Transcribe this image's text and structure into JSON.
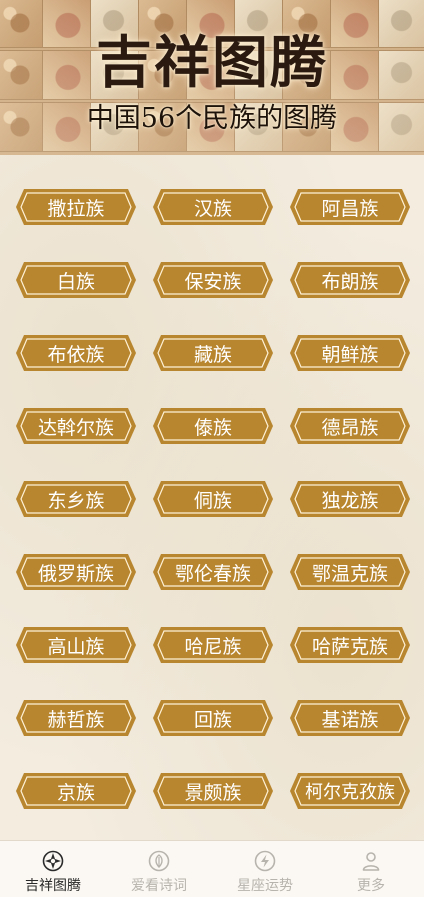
{
  "banner": {
    "title": "吉祥图腾",
    "subtitle": "中国56个民族的图腾"
  },
  "colors": {
    "pill_fill": "#b8862f",
    "pill_border": "#fff1d6",
    "background": "#f3ecdf",
    "tab_active": "#2a2a2a",
    "tab_inactive": "#b7b3ad"
  },
  "ethnic_groups": [
    "撒拉族",
    "汉族",
    "阿昌族",
    "白族",
    "保安族",
    "布朗族",
    "布依族",
    "藏族",
    "朝鲜族",
    "达斡尔族",
    "傣族",
    "德昂族",
    "东乡族",
    "侗族",
    "独龙族",
    "俄罗斯族",
    "鄂伦春族",
    "鄂温克族",
    "高山族",
    "哈尼族",
    "哈萨克族",
    "赫哲族",
    "回族",
    "基诺族",
    "京族",
    "景颇族",
    "柯尔克孜族"
  ],
  "tabs": [
    {
      "label": "吉祥图腾",
      "icon": "totem-icon",
      "active": true
    },
    {
      "label": "爱看诗词",
      "icon": "leaf-icon",
      "active": false
    },
    {
      "label": "星座运势",
      "icon": "lightning-icon",
      "active": false
    },
    {
      "label": "更多",
      "icon": "user-icon",
      "active": false
    }
  ]
}
